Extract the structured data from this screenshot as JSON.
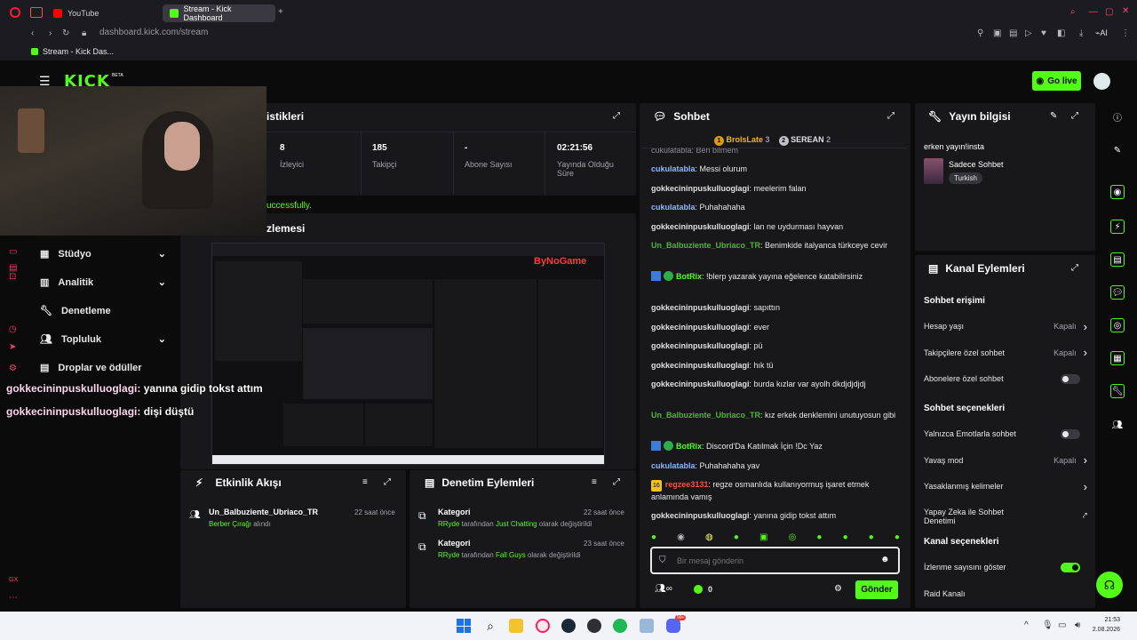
{
  "browser": {
    "tabs": [
      {
        "label": "YouTube"
      },
      {
        "label": "Stream - Kick Dashboard"
      }
    ],
    "url_host": "dashboard.kick.com",
    "url_path": "/stream",
    "bookmark": "Stream - Kick Das...",
    "ai_label": "AI"
  },
  "kick": {
    "logo": "KICK",
    "beta": "BETA",
    "go_live": "Go live"
  },
  "stats": {
    "title_fragment": "istikleri",
    "items": [
      {
        "value": "8",
        "label": "İzleyici"
      },
      {
        "value": "185",
        "label": "Takipçi"
      },
      {
        "value": "-",
        "label": "Abone Sayısı"
      },
      {
        "value": "02:21:56",
        "label": "Yayında Olduğu Süre"
      }
    ],
    "success_fragment": "uccessfully."
  },
  "preview": {
    "title_fragment": "zlemesi"
  },
  "left_nav": [
    {
      "label": "Stüdyo",
      "chev": true
    },
    {
      "label": "Analitik",
      "chev": true
    },
    {
      "label": "Denetleme",
      "chev": false
    },
    {
      "label": "Topluluk",
      "chev": true
    },
    {
      "label": "Droplar ve ödüller",
      "chev": false
    }
  ],
  "overlay_chat": [
    {
      "user": "gokkecininpuskulluoglagi",
      "text": ": yanına gidip tokst attım"
    },
    {
      "user": "gokkecininpuskulluoglagi",
      "text": ": dişi düştü"
    }
  ],
  "activity": {
    "title": "Etkinlik Akışı",
    "item": {
      "user": "Un_Balbuziente_Ubriaco_TR",
      "time": "22 saat önce",
      "detail_highlight": "Berber Çırağı",
      "detail_rest": " alındı"
    }
  },
  "moderation": {
    "title": "Denetim Eylemleri",
    "items": [
      {
        "title": "Kategori",
        "time": "22 saat önce",
        "by": "RRyde",
        "mid": " tarafından ",
        "target": "Just Chatting",
        "end": " olarak değiştirildi"
      },
      {
        "title": "Kategori",
        "time": "23 saat önce",
        "by": "RRyde",
        "mid": " tarafından ",
        "target": "Fall Guys",
        "end": " olarak değiştirildi"
      }
    ]
  },
  "chat": {
    "title": "Sohbet",
    "top": [
      {
        "rank": "1",
        "name": "BrolsLate",
        "count": "3"
      },
      {
        "rank": "2",
        "name": "SEREAN",
        "count": "2"
      }
    ],
    "cut_line": "cukulatabla: Ben bilmem",
    "messages": [
      {
        "user": "cukulatabla",
        "text": ": Messi olurum",
        "cls": "u2"
      },
      {
        "user": "gokkecininpuskulluoglagi",
        "text": ": meelerim falan",
        "cls": "u3"
      },
      {
        "user": "cukulatabla",
        "text": ": Puhahahaha",
        "cls": "u2"
      },
      {
        "user": "gokkecininpuskulluoglagi",
        "text": ": lan ne uydurması hayvan",
        "cls": "u3"
      },
      {
        "user": "Un_Balbuziente_Ubriaco_TR",
        "text": ": Benimkide italyanca türkceye cevir",
        "cls": "u4"
      },
      {
        "user": "BotRix",
        "text": ": !blerp yazarak yayına eğelence katabilirsiniz",
        "cls": "u5",
        "bot": true
      },
      {
        "user": "gokkecininpuskulluoglagi",
        "text": ": sapıttın",
        "cls": "u3"
      },
      {
        "user": "gokkecininpuskulluoglagi",
        "text": ": ever",
        "cls": "u3"
      },
      {
        "user": "gokkecininpuskulluoglagi",
        "text": ": pü",
        "cls": "u3"
      },
      {
        "user": "gokkecininpuskulluoglagi",
        "text": ": hık tü",
        "cls": "u3"
      },
      {
        "user": "gokkecininpuskulluoglagi",
        "text": ": burda kızlar var ayolh dkdjdjdjdj",
        "cls": "u3"
      },
      {
        "user": "Un_Balbuziente_Ubriaco_TR",
        "text": ": kız erkek denklemini unutuyosun gibi",
        "cls": "u4"
      },
      {
        "user": "BotRix",
        "text": ": Discord'Da Katılmak İçin !Dc Yaz",
        "cls": "u5",
        "bot": true
      },
      {
        "user": "cukulatabla",
        "text": ": Puhahahaha yav",
        "cls": "u2"
      },
      {
        "user": "regzee3131",
        "text": ": regze osmanlıda kullanıyormuş işaret etmek anlamında vamış",
        "cls": "u6",
        "badge": "16"
      },
      {
        "user": "gokkecininpuskulluoglagi",
        "text": ": yanına gidip tokst attım",
        "cls": "u3"
      },
      {
        "user": "gokkecininpuskulluoglagi",
        "text": ": dişi düştü",
        "cls": "u3"
      }
    ],
    "placeholder": "Bir mesaj gönderin",
    "points": "0",
    "send": "Gönder"
  },
  "stream_info": {
    "title": "Yayın bilgisi",
    "stream_title": "erken yayın!insta",
    "category": "Sadece Sohbet",
    "tag": "Turkish"
  },
  "channel_actions": {
    "title": "Kanal Eylemleri",
    "chat_access": "Sohbet erişimi",
    "rows1": [
      {
        "label": "Hesap yaşı",
        "value": "Kapalı",
        "kind": "arrow"
      },
      {
        "label": "Takipçilere özel sohbet",
        "value": "Kapalı",
        "kind": "arrow"
      },
      {
        "label": "Abonelere özel sohbet",
        "value": "",
        "kind": "toggle",
        "on": false
      }
    ],
    "chat_options": "Sohbet seçenekleri",
    "rows2": [
      {
        "label": "Yalnızca Emotlarla sohbet",
        "value": "",
        "kind": "toggle",
        "on": false
      },
      {
        "label": "Yavaş mod",
        "value": "Kapalı",
        "kind": "arrow"
      },
      {
        "label": "Yasaklanmış kelimeler",
        "value": "",
        "kind": "arrow"
      },
      {
        "label": "Yapay Zeka ile Sohbet Denetimi",
        "value": "",
        "kind": "ext"
      }
    ],
    "channel_options": "Kanal seçenekleri",
    "rows3": [
      {
        "label": "İzlenme sayısını göster",
        "value": "",
        "kind": "toggle",
        "on": true
      },
      {
        "label": "Raid Kanalı",
        "value": "",
        "kind": "none"
      }
    ]
  },
  "taskbar": {
    "time": "21:53",
    "date": "2.08.2026",
    "badge": "99+"
  },
  "colors": {
    "accent": "#53fc18",
    "panel": "#18181b",
    "bg": "#0e0e10"
  }
}
